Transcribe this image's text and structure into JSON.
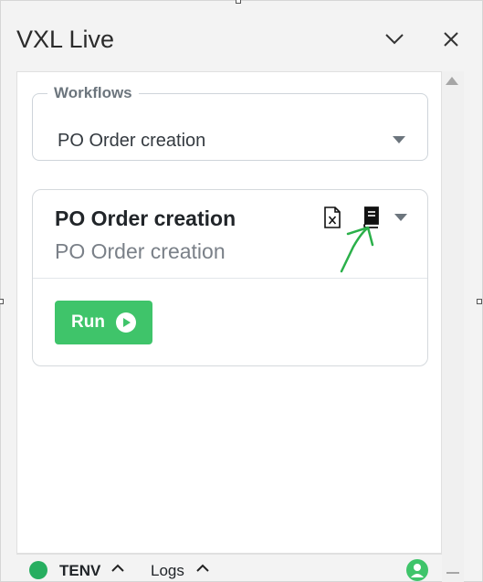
{
  "window": {
    "title": "VXL Live",
    "collapse_icon": "chevron-down-icon",
    "close_icon": "close-icon"
  },
  "workflows": {
    "label": "Workflows",
    "selected": "PO Order creation"
  },
  "card": {
    "title": "PO Order creation",
    "subtitle": "PO Order creation",
    "icons": [
      "excel-file-icon",
      "book-icon",
      "caret-down-icon"
    ],
    "run_label": "Run"
  },
  "footer": {
    "env_label": "TENV",
    "logs_label": "Logs",
    "status_color": "#27ae60"
  },
  "colors": {
    "run_button": "#3fc46a",
    "annotation_arrow": "#2bb04a"
  }
}
